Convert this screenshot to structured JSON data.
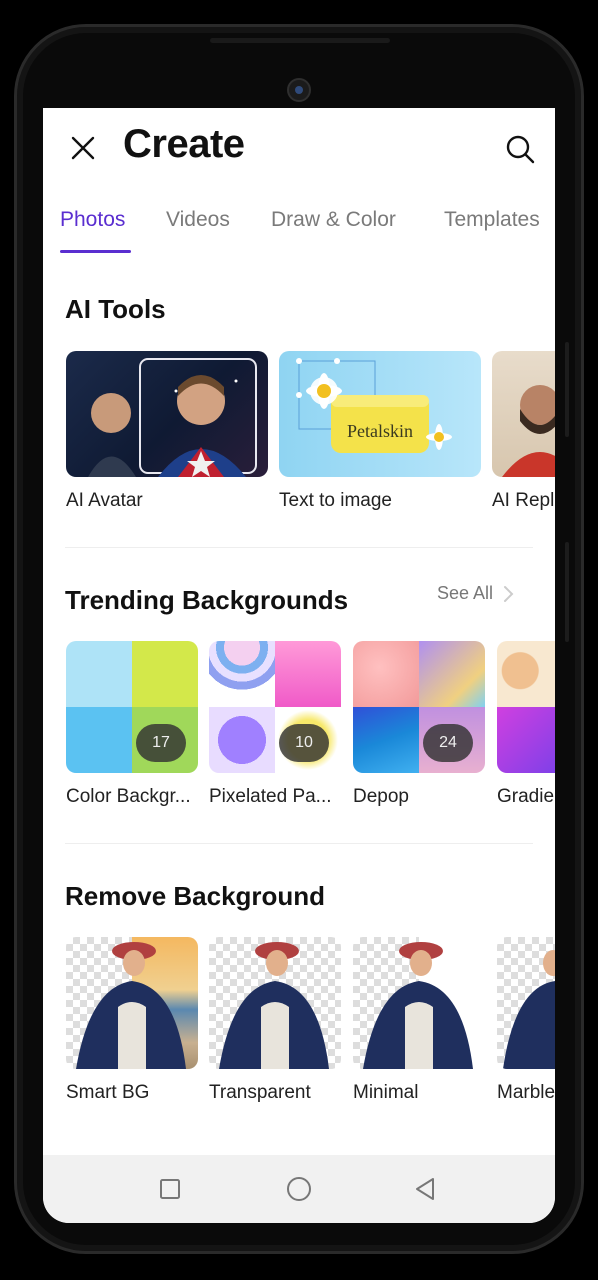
{
  "header": {
    "title": "Create"
  },
  "tabs": [
    {
      "label": "Photos",
      "active": true
    },
    {
      "label": "Videos"
    },
    {
      "label": "Draw & Color"
    },
    {
      "label": "Templates"
    }
  ],
  "ai_tools": {
    "title": "AI Tools",
    "items": [
      {
        "label": "AI Avatar"
      },
      {
        "label": "Text to image",
        "image_text": "Petalskin"
      },
      {
        "label": "AI Repl"
      }
    ]
  },
  "trending": {
    "title": "Trending Backgrounds",
    "see_all": "See All",
    "items": [
      {
        "label": "Color Backgr...",
        "count": "17"
      },
      {
        "label": "Pixelated Pa...",
        "count": "10"
      },
      {
        "label": "Depop",
        "count": "24"
      },
      {
        "label": "Gradie"
      }
    ]
  },
  "remove_bg": {
    "title": "Remove Background",
    "items": [
      {
        "label": "Smart BG"
      },
      {
        "label": "Transparent"
      },
      {
        "label": "Minimal"
      },
      {
        "label": "Marble"
      }
    ]
  },
  "colors": {
    "accent": "#5a2ed0",
    "text": "#111111",
    "muted": "#7a7a7a"
  },
  "icons": [
    "close-icon",
    "search-icon",
    "chevron-right-icon",
    "square-nav-icon",
    "circle-nav-icon",
    "back-triangle-icon"
  ]
}
